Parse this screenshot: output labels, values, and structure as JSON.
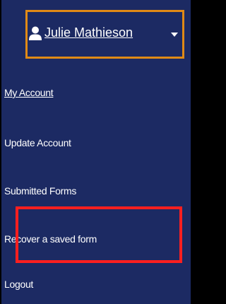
{
  "user_menu": {
    "user_name": "Julie Mathieson",
    "user_icon": "user-icon",
    "caret_icon": "caret-down-icon",
    "accent_border_color": "#e08a16"
  },
  "menu": {
    "items": [
      {
        "label": "My Account",
        "active": true
      },
      {
        "label": "Update Account",
        "active": false
      },
      {
        "label": "Submitted Forms",
        "active": false
      },
      {
        "label": "Recover a saved form",
        "active": false,
        "highlighted": true
      },
      {
        "label": "Logout",
        "active": false
      }
    ]
  },
  "colors": {
    "panel_background": "#1c2a63",
    "highlight": "#ff1f1f",
    "text": "#ffffff"
  }
}
